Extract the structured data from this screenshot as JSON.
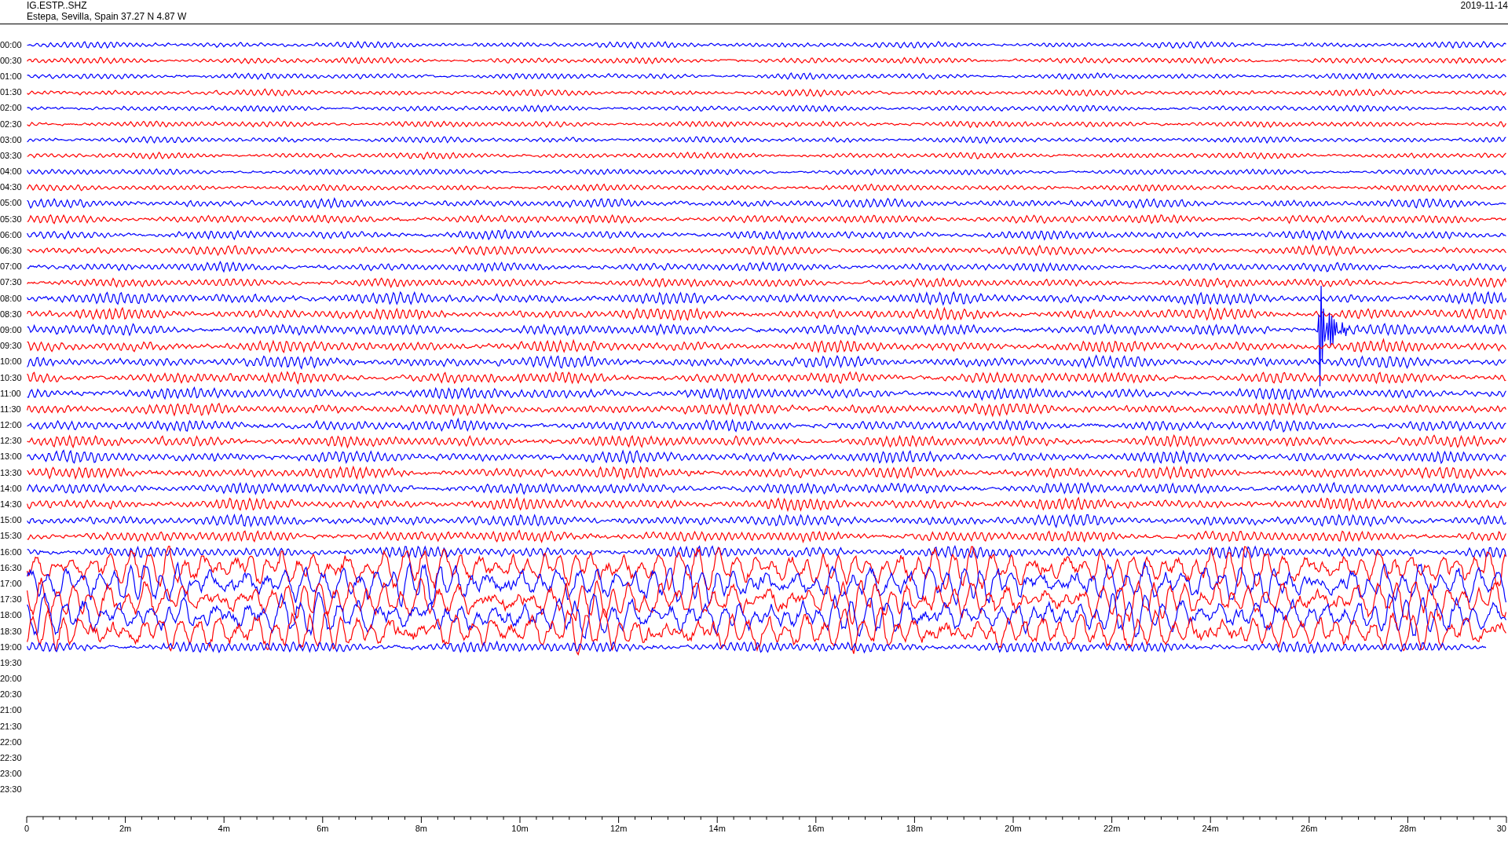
{
  "header": {
    "station": "IG.ESTP..SHZ",
    "location": "Estepa, Sevilla, Spain  37.27 N 4.87 W",
    "date": "2019-11-14"
  },
  "rows": [
    {
      "time": "00:00",
      "kind": "trace",
      "color": "#0000ff"
    },
    {
      "time": "00:30",
      "kind": "trace",
      "color": "#ff0000"
    },
    {
      "time": "01:00",
      "kind": "trace",
      "color": "#0000ff"
    },
    {
      "time": "01:30",
      "kind": "trace",
      "color": "#ff0000"
    },
    {
      "time": "02:00",
      "kind": "trace",
      "color": "#0000ff"
    },
    {
      "time": "02:30",
      "kind": "trace",
      "color": "#ff0000"
    },
    {
      "time": "03:00",
      "kind": "trace",
      "color": "#0000ff"
    },
    {
      "time": "03:30",
      "kind": "trace",
      "color": "#ff0000"
    },
    {
      "time": "04:00",
      "kind": "trace",
      "color": "#0000ff"
    },
    {
      "time": "04:30",
      "kind": "trace",
      "color": "#ff0000"
    },
    {
      "time": "05:00",
      "kind": "trace",
      "color": "#0000ff"
    },
    {
      "time": "05:30",
      "kind": "trace",
      "color": "#ff0000"
    },
    {
      "time": "06:00",
      "kind": "trace",
      "color": "#0000ff"
    },
    {
      "time": "06:30",
      "kind": "trace",
      "color": "#ff0000"
    },
    {
      "time": "07:00",
      "kind": "trace",
      "color": "#0000ff"
    },
    {
      "time": "07:30",
      "kind": "trace",
      "color": "#ff0000"
    },
    {
      "time": "08:00",
      "kind": "trace",
      "color": "#0000ff"
    },
    {
      "time": "08:30",
      "kind": "trace",
      "color": "#ff0000"
    },
    {
      "time": "09:00",
      "kind": "trace",
      "color": "#0000ff"
    },
    {
      "time": "09:30",
      "kind": "trace",
      "color": "#ff0000"
    },
    {
      "time": "10:00",
      "kind": "trace",
      "color": "#0000ff"
    },
    {
      "time": "10:30",
      "kind": "trace",
      "color": "#ff0000"
    },
    {
      "time": "11:00",
      "kind": "trace",
      "color": "#0000ff"
    },
    {
      "time": "11:30",
      "kind": "trace",
      "color": "#ff0000"
    },
    {
      "time": "12:00",
      "kind": "trace",
      "color": "#0000ff"
    },
    {
      "time": "12:30",
      "kind": "trace",
      "color": "#ff0000"
    },
    {
      "time": "13:00",
      "kind": "trace",
      "color": "#0000ff"
    },
    {
      "time": "13:30",
      "kind": "trace",
      "color": "#ff0000"
    },
    {
      "time": "14:00",
      "kind": "trace",
      "color": "#0000ff"
    },
    {
      "time": "14:30",
      "kind": "trace",
      "color": "#ff0000"
    },
    {
      "time": "15:00",
      "kind": "trace",
      "color": "#0000ff"
    },
    {
      "time": "15:30",
      "kind": "trace",
      "color": "#ff0000"
    },
    {
      "time": "16:00",
      "kind": "trace",
      "color": "#0000ff"
    },
    {
      "time": "16:30",
      "kind": "trace",
      "color": "#ff0000"
    },
    {
      "time": "17:00",
      "kind": "trace",
      "color": "#0000ff"
    },
    {
      "time": "17:30",
      "kind": "trace",
      "color": "#ff0000"
    },
    {
      "time": "18:00",
      "kind": "trace",
      "color": "#0000ff"
    },
    {
      "time": "18:30",
      "kind": "trace",
      "color": "#ff0000"
    },
    {
      "time": "19:00",
      "kind": "trace",
      "color": "#0000ff"
    },
    {
      "time": "19:30",
      "kind": "empty"
    },
    {
      "time": "20:00",
      "kind": "empty"
    },
    {
      "time": "20:30",
      "kind": "empty"
    },
    {
      "time": "21:00",
      "kind": "empty"
    },
    {
      "time": "21:30",
      "kind": "empty"
    },
    {
      "time": "22:00",
      "kind": "empty"
    },
    {
      "time": "22:30",
      "kind": "empty"
    },
    {
      "time": "23:00",
      "kind": "empty"
    },
    {
      "time": "23:30",
      "kind": "empty"
    }
  ],
  "x_axis": {
    "labels": [
      "0",
      "2m",
      "4m",
      "6m",
      "8m",
      "10m",
      "12m",
      "14m",
      "16m",
      "18m",
      "20m",
      "22m",
      "24m",
      "26m",
      "28m",
      "30"
    ]
  }
}
